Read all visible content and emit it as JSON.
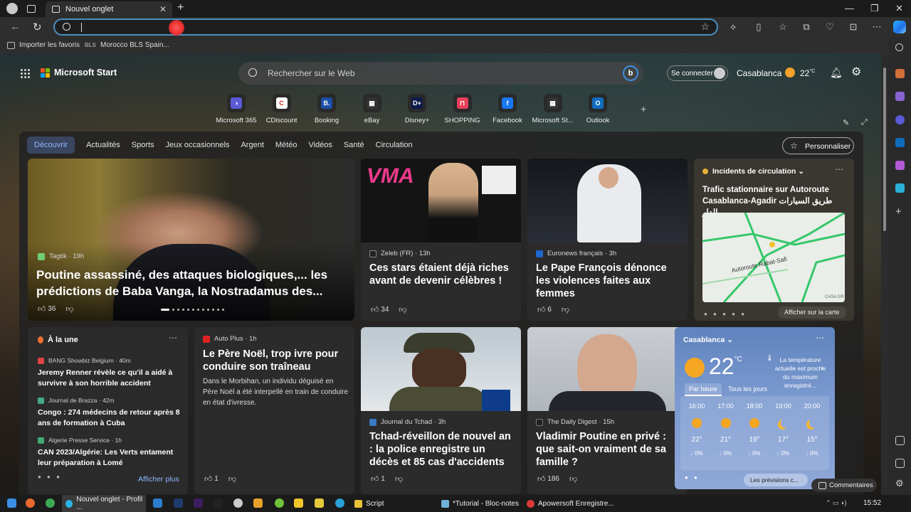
{
  "browser": {
    "tab_title": "Nouvel onglet",
    "favorites": [
      "Importer les favoris",
      "Morocco BLS Spain..."
    ],
    "favorites_prefix": "BLS"
  },
  "header": {
    "brand": "Microsoft Start",
    "search_placeholder": "Rechercher sur le Web",
    "signin": "Se connecter",
    "city": "Casablanca",
    "temperature": "22",
    "unit": "°C"
  },
  "quick_links": [
    {
      "label": "Microsoft 365",
      "color": "#5b5bd6",
      "glyph": "◑"
    },
    {
      "label": "CDiscount",
      "color": "#ffffff",
      "glyph": "C"
    },
    {
      "label": "Booking",
      "color": "#1b4fa8",
      "glyph": "B."
    },
    {
      "label": "eBay",
      "color": "#333333",
      "glyph": "▦"
    },
    {
      "label": "Disney+",
      "color": "#0c1a4a",
      "glyph": "D+"
    },
    {
      "label": "SHOPPING",
      "color": "#e8415c",
      "glyph": "⊓"
    },
    {
      "label": "Facebook",
      "color": "#1877f2",
      "glyph": "f"
    },
    {
      "label": "Microsoft St...",
      "color": "#333333",
      "glyph": "▦"
    },
    {
      "label": "Outlook",
      "color": "#0f6cbd",
      "glyph": "O"
    }
  ],
  "nav_tabs": [
    "Découvrir",
    "Actualités",
    "Sports",
    "Jeux occasionnels",
    "Argent",
    "Météo",
    "Vidéos",
    "Santé",
    "Circulation"
  ],
  "personalize": "Personnaliser",
  "hero": {
    "source": "Tagtik · 19h",
    "title": "Poutine assassiné, des attaques biologiques,... les prédictions de Baba Vanga, la Nostradamus des...",
    "likes": "36"
  },
  "cards": {
    "vma": {
      "source": "Zeleb (FR) · 13h",
      "title": "Ces stars étaient déjà riches avant de devenir célèbres !",
      "likes": "34",
      "img_text": "VMA"
    },
    "pope": {
      "source": "Euronews français · 3h",
      "title": "Le Pape François dénonce les violences faites aux femmes",
      "likes": "6"
    },
    "santa": {
      "source": "Auto Plus · 1h",
      "title": "Le Père Noël, trop ivre pour conduire son traîneau",
      "body": "Dans le Morbihan, un individu déguisé en Père Noël a été interpellé en train de conduire en état d'ivresse.",
      "likes": "1"
    },
    "tchad": {
      "source": "Journal du Tchad · 3h",
      "title": "Tchad-réveillon de nouvel an : la police enregistre un décès et 85 cas d'accidents",
      "likes": "1"
    },
    "putin2": {
      "source": "The Daily Digest · 15h",
      "title": "Vladimir Poutine en privé : que sait-on vraiment de sa famille ?",
      "likes": "186"
    }
  },
  "traffic": {
    "header": "Incidents de circulation",
    "title": "Trafic stationnaire sur Autoroute Casablanca-Agadir طريق السيارات الدار...",
    "road_label": "Autoroute Rabat-Safi",
    "map_label": "CASA GR",
    "cta": "Afficher sur la carte"
  },
  "alaune": {
    "header": "À la une",
    "items": [
      {
        "source": "BANG Showbiz Belgium · 40m",
        "title": "Jeremy Renner révèle ce qu'il a aidé à survivre à son horrible accident"
      },
      {
        "source": "Journal de Brazza · 42m",
        "title": "Congo : 274 médecins de retour après 8 ans de formation à Cuba"
      },
      {
        "source": "Algerie Presse Service · 1h",
        "title": "CAN 2023/Algérie: Les Verts entament leur préparation à Lomé"
      }
    ],
    "more": "Afficher plus"
  },
  "weather": {
    "city": "Casablanca",
    "temp": "22",
    "unit": "°C",
    "note": "La température actuelle est proche du maximum enregistré...",
    "tab_hourly": "Par heure",
    "tab_daily": "Tous les jours",
    "hours": [
      {
        "time": "16:00",
        "deg": "22°",
        "pct": "0%",
        "icon": "sun"
      },
      {
        "time": "17:00",
        "deg": "21°",
        "pct": "0%",
        "icon": "sun"
      },
      {
        "time": "18:00",
        "deg": "19°",
        "pct": "0%",
        "icon": "sun"
      },
      {
        "time": "19:00",
        "deg": "17°",
        "pct": "0%",
        "icon": "moon"
      },
      {
        "time": "20:00",
        "deg": "15°",
        "pct": "0%",
        "icon": "moon"
      }
    ],
    "forecast_link": "Les prévisions c..."
  },
  "comments": "Commentaires",
  "taskbar": {
    "windows": [
      "Nouvel onglet - Profil ...",
      "Script",
      "*Tutorial - Bloc-notes",
      "Apowersoft Enregistre..."
    ],
    "clock": "15:52"
  }
}
